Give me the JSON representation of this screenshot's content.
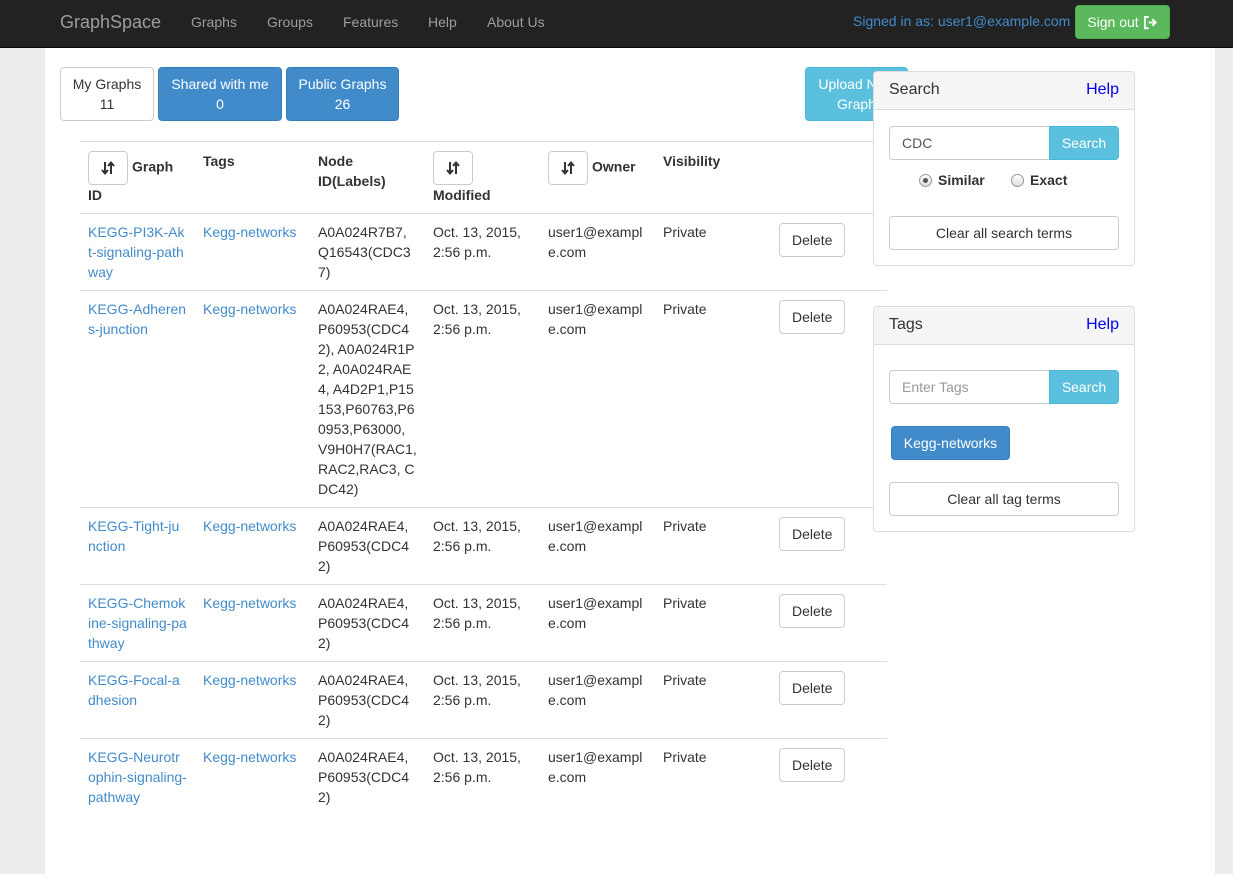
{
  "navbar": {
    "brand": "GraphSpace",
    "links": [
      "Graphs",
      "Groups",
      "Features",
      "Help",
      "About Us"
    ],
    "signed_in": "Signed in as: user1@example.com",
    "sign_out": "Sign out"
  },
  "tabs": {
    "my_graphs": {
      "label": "My Graphs",
      "count": "11"
    },
    "shared": {
      "label": "Shared with me",
      "count": "0"
    },
    "public": {
      "label": "Public Graphs",
      "count": "26"
    }
  },
  "upload": {
    "line1": "Upload New",
    "line2": "Graph"
  },
  "table": {
    "headers": [
      "Graph ID",
      "Tags",
      "Node ID(Labels)",
      "Modified",
      "Owner",
      "Visibility"
    ],
    "delete_label": "Delete",
    "rows": [
      {
        "graph_id": "KEGG-PI3K-Akt-signaling-pathway",
        "tags": "Kegg-networks",
        "nodes": "A0A024R7B7, Q16543(CDC37)",
        "modified": "Oct. 13, 2015, 2:56 p.m.",
        "owner": "user1@example.com",
        "visibility": "Private"
      },
      {
        "graph_id": "KEGG-Adherens-junction",
        "tags": "Kegg-networks",
        "nodes": "A0A024RAE4, P60953(CDC42), A0A024R1P2, A0A024RAE4, A4D2P1,P15153,P60763,P60953,P63000, V9H0H7(RAC1,RAC2,RAC3, CDC42)",
        "modified": "Oct. 13, 2015, 2:56 p.m.",
        "owner": "user1@example.com",
        "visibility": "Private"
      },
      {
        "graph_id": "KEGG-Tight-junction",
        "tags": "Kegg-networks",
        "nodes": "A0A024RAE4, P60953(CDC42)",
        "modified": "Oct. 13, 2015, 2:56 p.m.",
        "owner": "user1@example.com",
        "visibility": "Private"
      },
      {
        "graph_id": "KEGG-Chemokine-signaling-pathway",
        "tags": "Kegg-networks",
        "nodes": "A0A024RAE4, P60953(CDC42)",
        "modified": "Oct. 13, 2015, 2:56 p.m.",
        "owner": "user1@example.com",
        "visibility": "Private"
      },
      {
        "graph_id": "KEGG-Focal-adhesion",
        "tags": "Kegg-networks",
        "nodes": "A0A024RAE4, P60953(CDC42)",
        "modified": "Oct. 13, 2015, 2:56 p.m.",
        "owner": "user1@example.com",
        "visibility": "Private"
      },
      {
        "graph_id": "KEGG-Neurotrophin-signaling-pathway",
        "tags": "Kegg-networks",
        "nodes": "A0A024RAE4, P60953(CDC42)",
        "modified": "Oct. 13, 2015, 2:56 p.m.",
        "owner": "user1@example.com",
        "visibility": "Private"
      }
    ]
  },
  "search_panel": {
    "title": "Search",
    "help": "Help",
    "input_value": "CDC",
    "search_button": "Search",
    "radio_similar": "Similar",
    "radio_exact": "Exact",
    "selected": "Similar",
    "clear": "Clear all search terms"
  },
  "tags_panel": {
    "title": "Tags",
    "help": "Help",
    "placeholder": "Enter Tags",
    "search_button": "Search",
    "active_tag": "Kegg-networks",
    "clear": "Clear all tag terms"
  },
  "icons": {
    "sort": "sort-icon",
    "sign_out": "sign-out-icon"
  },
  "colors": {
    "navbar": "#222222",
    "primary": "#428bca",
    "info": "#5bc0de",
    "success": "#5cb85c"
  }
}
